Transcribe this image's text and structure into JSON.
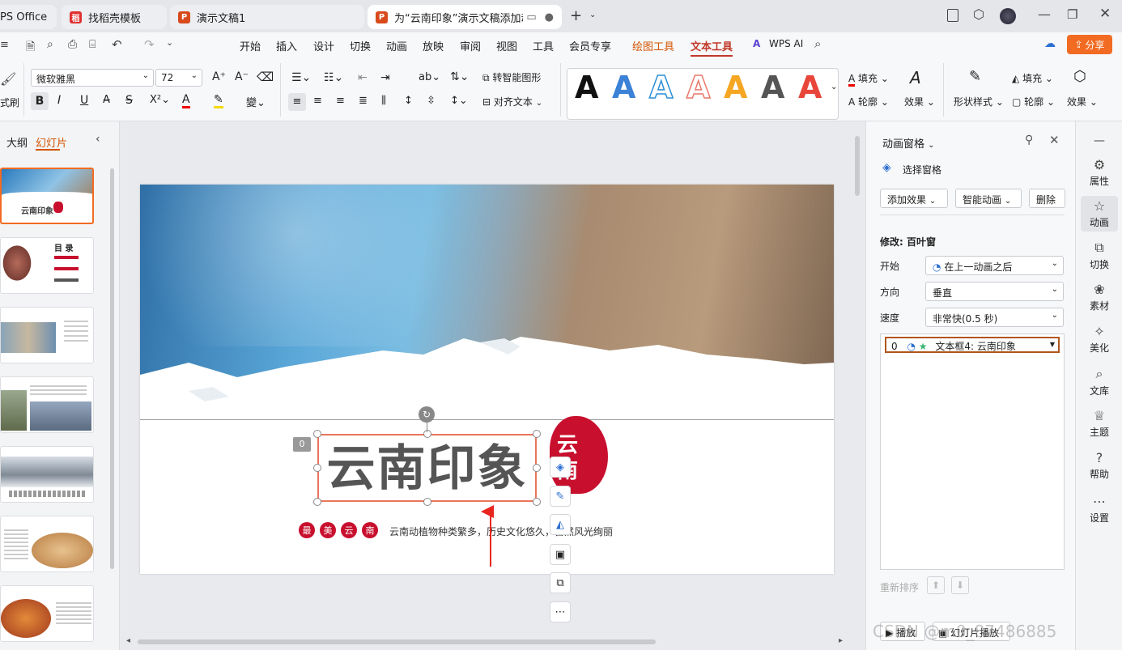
{
  "tabs": [
    {
      "label": "PS Office",
      "icon": "wps-icon"
    },
    {
      "label": "找稻壳模板",
      "icon": "docer-icon"
    },
    {
      "label": "演示文稿1",
      "icon": "ppt-icon"
    },
    {
      "label": "为“云南印象”演示文稿添加动",
      "icon": "ppt-icon"
    }
  ],
  "menu": {
    "items": [
      "开始",
      "插入",
      "设计",
      "切换",
      "动画",
      "放映",
      "审阅",
      "视图",
      "工具",
      "会员专享"
    ],
    "drawing_tools": "绘图工具",
    "text_tools": "文本工具",
    "wps_ai": "WPS AI",
    "share": "分享"
  },
  "ribbon": {
    "font_name": "微软雅黑",
    "font_size": "72",
    "smart_shape": "转智能图形",
    "align_text": "对齐文本",
    "fill": "填充",
    "outline": "轮廓",
    "effect": "效果",
    "shape_style": "形状样式",
    "fill2": "填充",
    "outline2": "轮廓",
    "effect2": "效果",
    "format_painter": "式刷",
    "wordart_letter": "A"
  },
  "left_panel": {
    "tab_outline": "大纲",
    "tab_slides": "幻灯片",
    "thumb_titles": [
      "云南印象",
      "目 录"
    ]
  },
  "slide": {
    "title": "云南印象",
    "anim_badge": "0",
    "dots": [
      "最",
      "美",
      "云",
      "南"
    ],
    "caption": "云南动植物种类繁多，历史文化悠久，自然风光绚丽",
    "seal_text": "云南"
  },
  "anim_panel": {
    "title": "动画窗格",
    "select_pane": "选择窗格",
    "add_effect": "添加效果",
    "smart_anim": "智能动画",
    "delete": "删除",
    "modify": "修改: 百叶窗",
    "start_label": "开始",
    "start_value": "在上一动画之后",
    "direction_label": "方向",
    "direction_value": "垂直",
    "speed_label": "速度",
    "speed_value": "非常快(0.5 秒)",
    "item_index": "0",
    "item_text": "文本框4: 云南印象",
    "reorder": "重新排序",
    "play": "播放",
    "slideshow": "幻灯片播放"
  },
  "right_bar": [
    "属性",
    "动画",
    "切换",
    "素材",
    "美化",
    "文库",
    "主题",
    "帮助",
    "设置"
  ],
  "watermark": "CSDN @m0_87486885"
}
